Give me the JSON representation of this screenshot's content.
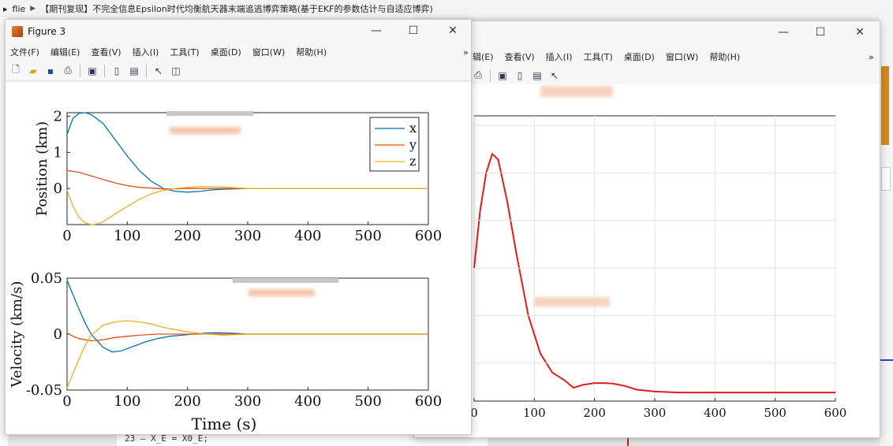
{
  "background": {
    "breadcrumb": [
      "flie",
      "【期刊复现】不完全信息Epsilon时代均衡航天器末端追逃博弈策略(基于EKF的参数估计与自适应博弈)"
    ],
    "code_line": "23 —        X_E = X0_E;"
  },
  "figure3": {
    "title": "Figure 3",
    "menu": [
      "文件(F)",
      "编辑(E)",
      "查看(V)",
      "插入(I)",
      "工具(T)",
      "桌面(D)",
      "窗口(W)",
      "帮助(H)"
    ],
    "chevron": "»",
    "toolbar_icons": [
      "new-file-icon",
      "open-folder-icon",
      "save-icon",
      "print-icon",
      "link-plot-icon",
      "colorbar-icon",
      "legend-icon",
      "pointer-icon",
      "property-inspector-icon"
    ]
  },
  "figure_back": {
    "menu": [
      "辑(E)",
      "查看(V)",
      "插入(I)",
      "工具(T)",
      "桌面(D)",
      "窗口(W)",
      "帮助(H)"
    ],
    "chevron": "»"
  },
  "colors": {
    "x": "#0072bd",
    "y": "#d95319",
    "z": "#edb120",
    "red": "#e01d1d"
  },
  "chart_data": [
    {
      "type": "line",
      "ylabel": "Position (km)",
      "xlabel": "",
      "xlim": [
        0,
        600
      ],
      "ylim": [
        -1,
        2.1
      ],
      "xticks": [
        "0",
        "100",
        "200",
        "300",
        "400",
        "500",
        "600"
      ],
      "yticks": [
        "2",
        "1",
        "0"
      ],
      "legend": [
        "x",
        "y",
        "z"
      ],
      "legend_placement": "top-right",
      "series": [
        {
          "name": "x",
          "x": [
            0,
            10,
            20,
            30,
            40,
            60,
            80,
            100,
            120,
            140,
            160,
            180,
            200,
            220,
            240,
            260,
            300,
            600
          ],
          "y": [
            1.5,
            1.95,
            2.08,
            2.1,
            2.05,
            1.8,
            1.35,
            0.9,
            0.5,
            0.2,
            0.0,
            -0.08,
            -0.1,
            -0.08,
            -0.04,
            -0.02,
            0,
            0
          ]
        },
        {
          "name": "y",
          "x": [
            0,
            20,
            40,
            60,
            80,
            100,
            120,
            140,
            160,
            180,
            200,
            600
          ],
          "y": [
            0.5,
            0.45,
            0.35,
            0.25,
            0.15,
            0.08,
            0.03,
            0.01,
            -0.01,
            -0.01,
            0,
            0
          ]
        },
        {
          "name": "z",
          "x": [
            0,
            10,
            20,
            30,
            40,
            50,
            60,
            80,
            100,
            120,
            140,
            160,
            180,
            200,
            220,
            240,
            260,
            280,
            300,
            600
          ],
          "y": [
            -0.05,
            -0.5,
            -0.8,
            -0.95,
            -1.0,
            -0.98,
            -0.92,
            -0.7,
            -0.5,
            -0.3,
            -0.15,
            -0.05,
            0.0,
            0.03,
            0.05,
            0.05,
            0.04,
            0.02,
            0,
            0
          ]
        }
      ]
    },
    {
      "type": "line",
      "ylabel": "Velocity (km/s)",
      "xlabel": "Time (s)",
      "xlim": [
        0,
        600
      ],
      "ylim": [
        -0.05,
        0.05
      ],
      "xticks": [
        "0",
        "100",
        "200",
        "300",
        "400",
        "500",
        "600"
      ],
      "yticks": [
        "0.05",
        "0",
        "-0.05"
      ],
      "series": [
        {
          "name": "x",
          "x": [
            0,
            10,
            20,
            30,
            40,
            60,
            75,
            90,
            110,
            130,
            150,
            170,
            190,
            210,
            230,
            250,
            270,
            300,
            600
          ],
          "y": [
            0.048,
            0.035,
            0.022,
            0.01,
            0.0,
            -0.012,
            -0.016,
            -0.015,
            -0.011,
            -0.007,
            -0.004,
            -0.002,
            -0.001,
            0,
            0.001,
            0.0012,
            0.001,
            0,
            0
          ]
        },
        {
          "name": "y",
          "x": [
            0,
            10,
            20,
            40,
            60,
            80,
            100,
            120,
            150,
            180,
            210,
            600
          ],
          "y": [
            0.001,
            -0.002,
            -0.004,
            -0.006,
            -0.005,
            -0.003,
            -0.002,
            -0.001,
            0,
            0,
            0,
            0
          ]
        },
        {
          "name": "z",
          "x": [
            0,
            10,
            20,
            30,
            40,
            60,
            80,
            100,
            120,
            140,
            160,
            180,
            200,
            230,
            260,
            300,
            600
          ],
          "y": [
            -0.048,
            -0.035,
            -0.022,
            -0.01,
            -0.001,
            0.008,
            0.011,
            0.012,
            0.011,
            0.009,
            0.006,
            0.004,
            0.002,
            0.0,
            -0.001,
            0,
            0
          ]
        }
      ]
    },
    {
      "type": "line",
      "xlim": [
        0,
        600
      ],
      "xticks": [
        "0",
        "100",
        "200",
        "300",
        "400",
        "500",
        "600"
      ],
      "series": [
        {
          "x": [
            0,
            10,
            20,
            30,
            40,
            55,
            70,
            90,
            110,
            130,
            150,
            165,
            180,
            200,
            215,
            230,
            250,
            270,
            300,
            340,
            400,
            600
          ],
          "y": [
            0.6,
            0.9,
            1.1,
            1.2,
            1.17,
            0.95,
            0.68,
            0.35,
            0.15,
            0.05,
            0.01,
            -0.03,
            -0.015,
            -0.005,
            -0.005,
            -0.008,
            -0.02,
            -0.04,
            -0.05,
            -0.055,
            -0.055,
            -0.055
          ]
        }
      ]
    }
  ]
}
